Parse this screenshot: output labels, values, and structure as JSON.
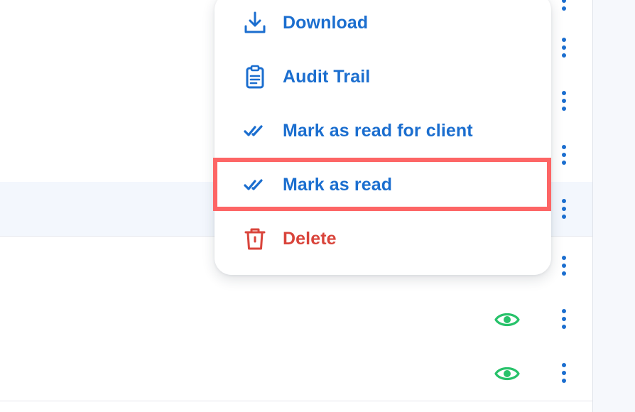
{
  "menu": {
    "items": [
      {
        "label": "Download",
        "icon": "download-icon"
      },
      {
        "label": "Audit Trail",
        "icon": "clipboard-icon"
      },
      {
        "label": "Mark as read for client",
        "icon": "double-check-icon"
      },
      {
        "label": "Mark as read",
        "icon": "double-check-icon"
      },
      {
        "label": "Delete",
        "icon": "trash-icon"
      }
    ]
  },
  "colors": {
    "accent": "#1b6ecf",
    "danger": "#d9443b",
    "eye": "#27c26a",
    "highlight_border": "#fd6565",
    "row_highlight": "#f3f7fd"
  }
}
